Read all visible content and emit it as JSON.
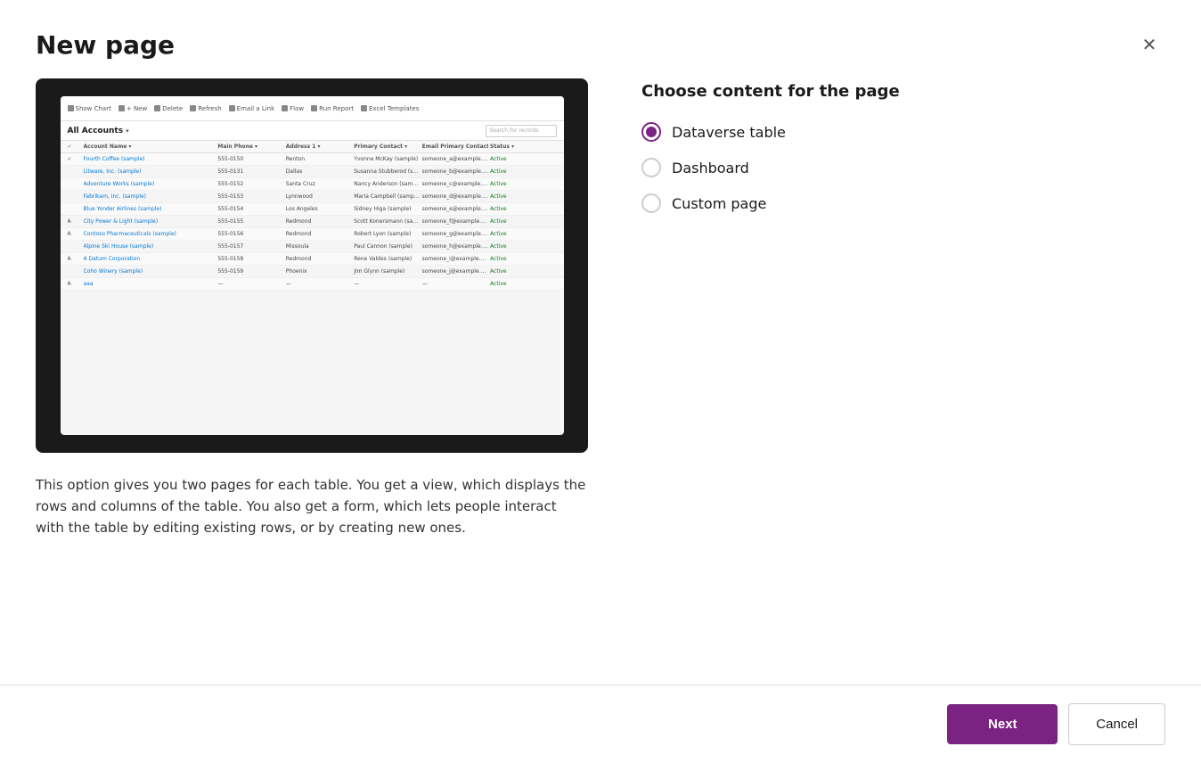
{
  "dialog": {
    "title": "New page",
    "close_icon": "✕"
  },
  "right_panel": {
    "heading": "Choose content for the page",
    "options": [
      {
        "id": "dataverse",
        "label": "Dataverse table",
        "selected": true
      },
      {
        "id": "dashboard",
        "label": "Dashboard",
        "selected": false
      },
      {
        "id": "custom",
        "label": "Custom page",
        "selected": false
      }
    ]
  },
  "preview": {
    "title": "All Accounts",
    "search_placeholder": "Search for records",
    "toolbar_items": [
      "Show Chart",
      "+ New",
      "Delete",
      "Refresh",
      "Email a Link",
      "Flow",
      "Run Report",
      "Excel Templates"
    ],
    "columns": [
      "",
      "Account Name",
      "Main Phone",
      "Address 1",
      "Primary Contact",
      "Email Primary Contact",
      "Status"
    ],
    "rows": [
      [
        "✓",
        "Fourth Coffee (sample)",
        "555-0150",
        "Renton",
        "Yvonne McKay (sample)",
        "someone_a@example.com",
        "Active"
      ],
      [
        "",
        "Litware, Inc. (sample)",
        "555-0131",
        "Dallas",
        "Susanna Stubberod (samp...",
        "someone_b@example.com",
        "Active"
      ],
      [
        "",
        "Adventure Works (sample)",
        "555-0152",
        "Santa Cruz",
        "Nancy Anderson (sample)",
        "someone_c@example.com",
        "Active"
      ],
      [
        "",
        "Fabrikam, Inc. (sample)",
        "555-0153",
        "Lynnwood",
        "Maria Campbell (sample)",
        "someone_d@example.com",
        "Active"
      ],
      [
        "",
        "Blue Yonder Airlines (sample)",
        "555-0154",
        "Los Angeles",
        "Sidney Higa (sample)",
        "someone_e@example.com",
        "Active"
      ],
      [
        "A",
        "City Power & Light (sample)",
        "555-0155",
        "Redmond",
        "Scott Konersmann (samp...",
        "someone_f@example.com",
        "Active"
      ],
      [
        "A",
        "Contoso Pharmaceuticals (sample)",
        "555-0156",
        "Redmond",
        "Robert Lyon (sample)",
        "someone_g@example.com",
        "Active"
      ],
      [
        "",
        "Alpine Ski House (sample)",
        "555-0157",
        "Missoula",
        "Paul Cannon (sample)",
        "someone_h@example.com",
        "Active"
      ],
      [
        "A",
        "A Datum Corporation",
        "555-0158",
        "Redmond",
        "Rene Valdes (sample)",
        "someone_i@example.com",
        "Active"
      ],
      [
        "",
        "Coho Winery (sample)",
        "555-0159",
        "Phoenix",
        "Jim Glynn (sample)",
        "someone_j@example.com",
        "Active"
      ],
      [
        "A",
        "aaa",
        "—",
        "—",
        "—",
        "—",
        "Active"
      ]
    ]
  },
  "description": "This option gives you two pages for each table. You get a view, which displays the rows and columns of the table. You also get a form, which lets people interact with the table by editing existing rows, or by creating new ones.",
  "footer": {
    "next_label": "Next",
    "cancel_label": "Cancel"
  }
}
